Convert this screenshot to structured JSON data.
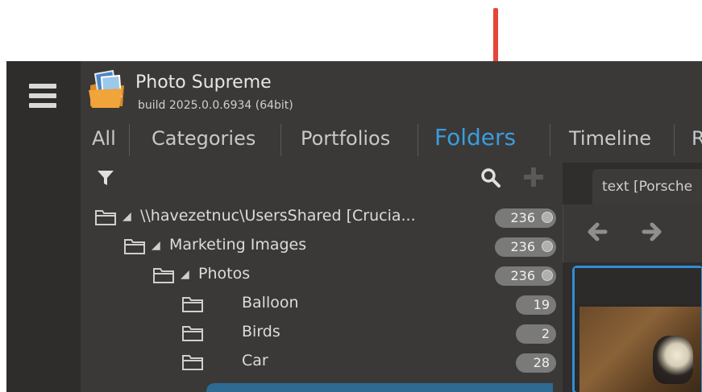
{
  "app": {
    "title": "Photo Supreme",
    "build": "build 2025.0.0.6934 (64bit)"
  },
  "tabs": [
    {
      "label": "All"
    },
    {
      "label": "Categories"
    },
    {
      "label": "Portfolios"
    },
    {
      "label": "Folders",
      "active": true
    },
    {
      "label": "Timeline"
    },
    {
      "label": "R"
    }
  ],
  "tree": {
    "rows": [
      {
        "label": "\\\\havezetnuc\\UsersShared  [Crucia...",
        "count": "236"
      },
      {
        "label": "Marketing Images",
        "count": "236"
      },
      {
        "label": "Photos",
        "count": "236"
      },
      {
        "label": "Balloon",
        "count": "19"
      },
      {
        "label": "Birds",
        "count": "2"
      },
      {
        "label": "Car",
        "count": "28"
      }
    ]
  },
  "preview": {
    "tab_label": "text [Porsche"
  },
  "colors": {
    "accent": "#3a9ce0",
    "arrow": "#e8443a",
    "panel": "#3a3937"
  },
  "icons": {
    "menu": "hamburger-icon",
    "filter": "filter-icon",
    "search": "search-icon",
    "add": "plus-icon",
    "back": "arrow-left-icon",
    "forward": "arrow-right-icon",
    "folder": "folder-icon"
  }
}
